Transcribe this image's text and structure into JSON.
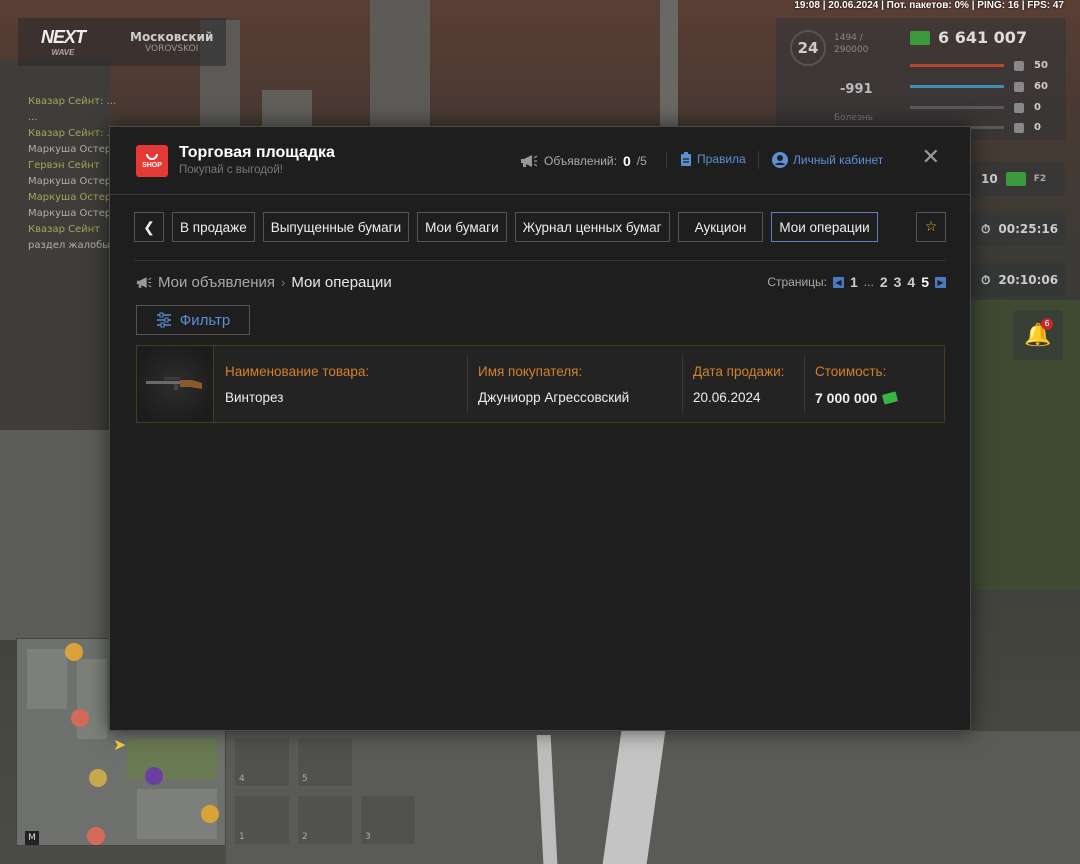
{
  "status_bar": "19:08 | 20.06.2024 | Пот. пакетов: 0% | PING: 16 | FPS: 47",
  "game_logo": {
    "l1": "NEXT",
    "l2": "WAVE"
  },
  "server": {
    "name": "Московский",
    "sub": "VOROVSKOI"
  },
  "chat_lines": [
    "Квазар Сейнт: ...",
    "...",
    "Квазар Сейнт: ...",
    "Маркуша Остер",
    "Гервэн Сейнт",
    "Маркуша Остер",
    "Маркуша Остер",
    "Маркуша Остер",
    "Квазар Сейнт",
    "раздел жалобы"
  ],
  "hud": {
    "level": "24",
    "exp": "1494 /",
    "exp_max": "290000",
    "money": "6 641 007",
    "health": "50",
    "armor": "60",
    "hunger": "0",
    "shield": "0",
    "minus": "-991",
    "sick": "Болезнь",
    "cash_small": "10",
    "key_f2": "F2",
    "timer1": "00:25:16",
    "timer2": "20:10:06",
    "notify_count": "6"
  },
  "minimap_label": "M",
  "inventory_slots": [
    "4",
    "5",
    "1",
    "2",
    "3"
  ],
  "modal": {
    "title": "Торговая площадка",
    "subtitle": "Покупай с выгодой!",
    "shop_badge": "SHOP",
    "ads_label": "Объявлений:",
    "ads_count": "0",
    "ads_max": "/5",
    "rules_link": "Правила",
    "cabinet_link": "Личный кабинет",
    "close_glyph": "✕"
  },
  "tabs": [
    {
      "label": "В продаже"
    },
    {
      "label": "Выпущенные бумаги"
    },
    {
      "label": "Мои бумаги"
    },
    {
      "label": "Журнал ценных бумаг"
    },
    {
      "label": "Аукцион"
    },
    {
      "label": "Мои операции",
      "active": true
    }
  ],
  "breadcrumb": {
    "root": "Мои объявления",
    "current": "Мои операции"
  },
  "pager": {
    "label": "Страницы:",
    "pages": [
      "1",
      "2",
      "3",
      "4",
      "5"
    ],
    "current": "5",
    "dots": "..."
  },
  "filter_label": "Фильтр",
  "operations": [
    {
      "item_label": "Наименование товара:",
      "item_value": "Винторез",
      "buyer_label": "Имя покупателя:",
      "buyer_value": "Джуниорр Агрессовский",
      "date_label": "Дата продажи:",
      "date_value": "20.06.2024",
      "price_label": "Стоимость:",
      "price_value": "7 000 000"
    }
  ],
  "colors": {
    "accent_blue": "#5b8fd6",
    "label_orange": "#d4822a",
    "shop_red": "#e53935",
    "star_gold": "#e6b325"
  }
}
